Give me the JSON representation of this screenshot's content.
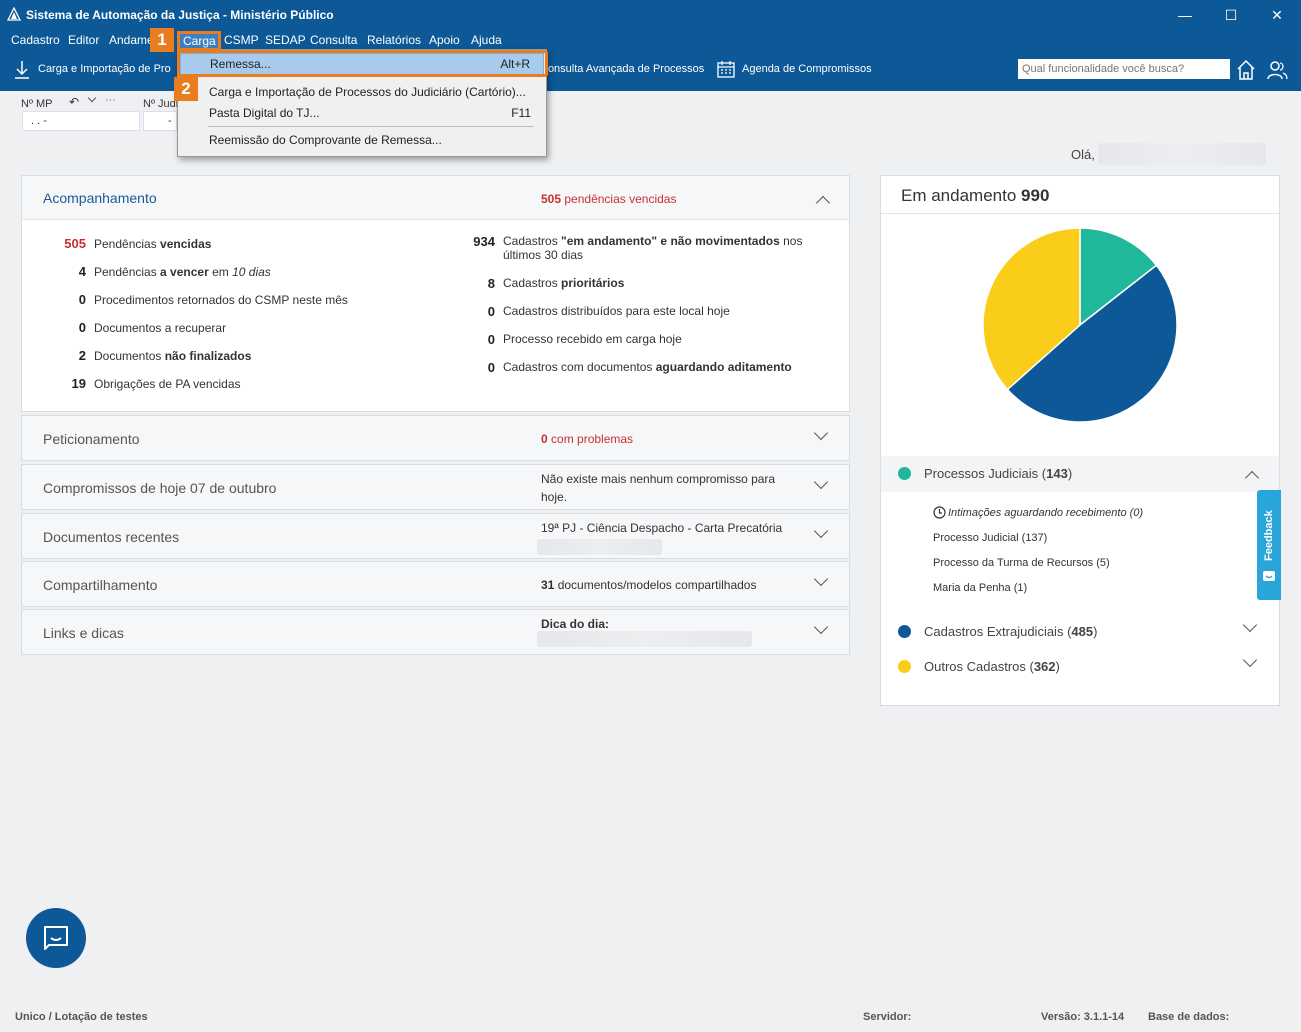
{
  "window": {
    "title": "Sistema de Automação da Justiça - Ministério Público",
    "minimize": "—",
    "maximize": "☐",
    "close": "✕"
  },
  "menu": [
    "Cadastro",
    "Editor",
    "Andame",
    "Carga",
    "CSMP",
    "SEDAP",
    "Consulta",
    "Relatórios",
    "Apoio",
    "Ajuda"
  ],
  "toolbar": {
    "carga": "Carga e Importação de Pro",
    "consulta": "Consulta Avançada de Processos",
    "agenda": "Agenda de Compromissos",
    "search_placeholder": "Qual funcionalidade você busca?"
  },
  "dropdown": {
    "items": [
      {
        "label": "Remessa...",
        "shortcut": "Alt+R"
      },
      {
        "label": "Carga e Importação de Processos do Judiciário (Cartório)...",
        "shortcut": ""
      },
      {
        "label": "Pasta Digital do TJ...",
        "shortcut": "F11"
      },
      {
        "label": "Reemissão do Comprovante de Remessa...",
        "shortcut": ""
      }
    ],
    "badge1": "1",
    "badge2": "2"
  },
  "fields": {
    "nmp_label": "Nº MP",
    "nmp_value": ". .  -",
    "njud_label": "Nº Judi",
    "njud_value": "-"
  },
  "greeting": "Olá,",
  "acompanhamento": {
    "title": "Acompanhamento",
    "summary_num": "505",
    "summary_text": "pendências vencidas",
    "left": [
      {
        "num": "505",
        "text": "Pendências ",
        "bold": "vencidas",
        "rest": ""
      },
      {
        "num": "4",
        "text": "Pendências ",
        "bold": "a vencer",
        "rest": " em 10 dias"
      },
      {
        "num": "0",
        "text": "Procedimentos retornados do CSMP neste mês",
        "bold": "",
        "rest": ""
      },
      {
        "num": "0",
        "text": "Documentos a recuperar",
        "bold": "",
        "rest": ""
      },
      {
        "num": "2",
        "text": "Documentos ",
        "bold": "não finalizados",
        "rest": ""
      },
      {
        "num": "19",
        "text": "Obrigações de PA vencidas",
        "bold": "",
        "rest": ""
      }
    ],
    "right": [
      {
        "num": "934",
        "text": "Cadastros ",
        "bold": "\"em andamento\" e não movimentados",
        "rest": " nos",
        "line2": "últimos 30 dias"
      },
      {
        "num": "8",
        "text": "Cadastros ",
        "bold": "prioritários",
        "rest": ""
      },
      {
        "num": "0",
        "text": "Cadastros distribuídos para este local hoje",
        "bold": "",
        "rest": ""
      },
      {
        "num": "0",
        "text": "Processo recebido em carga hoje",
        "bold": "",
        "rest": ""
      },
      {
        "num": "0",
        "text": "Cadastros com documentos ",
        "bold": "aguardando aditamento",
        "rest": ""
      }
    ]
  },
  "accordions": [
    {
      "title": "Peticionamento",
      "info_num": "0",
      "info": "com problemas"
    },
    {
      "title": "Compromissos de hoje 07 de outubro",
      "info_num": "",
      "info": "Não existe mais nenhum compromisso para hoje."
    },
    {
      "title": "Documentos recentes",
      "info_num": "",
      "info": "19ª PJ - Ciência Despacho - Carta Precatória"
    },
    {
      "title": "Compartilhamento",
      "info_num": "31",
      "info": "documentos/modelos compartilhados"
    },
    {
      "title": "Links e dicas",
      "info_num": "",
      "info": "Dica do dia:"
    }
  ],
  "andamento": {
    "title": "Em andamento",
    "total": "990",
    "groups": [
      {
        "label": "Processos Judiciais",
        "count": "143",
        "color": "#1fb89a"
      },
      {
        "label": "Cadastros Extrajudiciais",
        "count": "485",
        "color": "#0d5897"
      },
      {
        "label": "Outros Cadastros",
        "count": "362",
        "color": "#f9cd1a"
      }
    ],
    "sub_items": [
      "Intimações aguardando recebimento (0)",
      "Processo Judicial (137)",
      "Processo da Turma de Recursos (5)",
      "Maria da Penha (1)"
    ]
  },
  "chart_data": {
    "type": "pie",
    "categories": [
      "Processos Judiciais",
      "Cadastros Extrajudiciais",
      "Outros Cadastros"
    ],
    "values": [
      143,
      485,
      362
    ],
    "colors": [
      "#1fb89a",
      "#0d5897",
      "#f9cd1a"
    ]
  },
  "feedback": "Feedback",
  "status": {
    "left": "Unico / Lotação de testes",
    "servidor": "Servidor:",
    "versao": "Versão: 3.1.1-14",
    "base": "Base de dados:"
  }
}
